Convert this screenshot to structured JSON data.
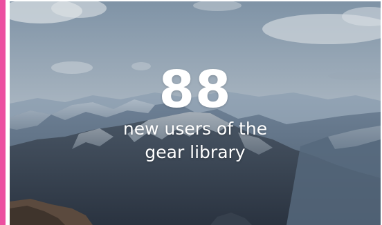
{
  "stat": {
    "number": "88",
    "caption_line1": "new users of the",
    "caption_line2": "gear library"
  },
  "colors": {
    "accent": "#ec4fa0",
    "text": "#ffffff"
  },
  "background": {
    "image": "mountain-landscape-photo"
  }
}
